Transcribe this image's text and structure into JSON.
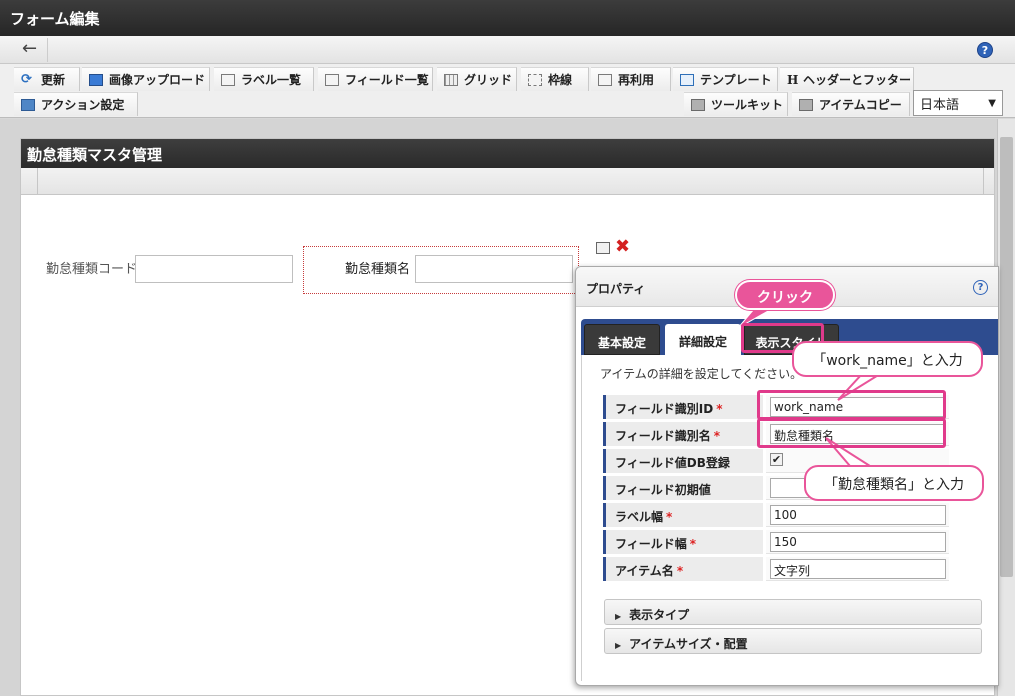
{
  "window": {
    "title": "フォーム編集"
  },
  "nav": {
    "back_icon": "←",
    "help_icon": "?"
  },
  "toolbar": {
    "row1": [
      "更新",
      "画像アップロード",
      "ラベル一覧",
      "フィールド一覧",
      "グリッド",
      "枠線",
      "再利用",
      "テンプレート",
      "ヘッダーとフッター"
    ],
    "row2_left": [
      "アクション設定"
    ],
    "row2_right": [
      "ツールキット",
      "アイテムコピー"
    ],
    "language": "日本語"
  },
  "form": {
    "title": "勤怠種類マスタ管理",
    "field1_label": "勤怠種類コード",
    "field2_label": "勤怠種類名"
  },
  "properties": {
    "title": "プロパティ",
    "help_icon": "?",
    "tabs": [
      "基本設定",
      "詳細設定",
      "表示スタイル"
    ],
    "active_tab": "詳細設定",
    "description": "アイテムの詳細を設定してください。",
    "rows": [
      {
        "label": "フィールド識別ID",
        "required": "*",
        "value": "work_name"
      },
      {
        "label": "フィールド識別名",
        "required": "*",
        "value": "勤怠種類名"
      },
      {
        "label": "フィールド値DB登録",
        "required": "",
        "checked": "✔"
      },
      {
        "label": "フィールド初期値",
        "required": "",
        "value": ""
      },
      {
        "label": "ラベル幅",
        "required": "*",
        "value": "100"
      },
      {
        "label": "フィールド幅",
        "required": "*",
        "value": "150"
      },
      {
        "label": "アイテム名",
        "required": "*",
        "value": "文字列"
      }
    ],
    "accordions": [
      "表示タイプ",
      "アイテムサイズ・配置"
    ]
  },
  "annotations": {
    "click": "クリック",
    "input_id": "「work_name」と入力",
    "input_name": "「勤怠種類名」と入力"
  },
  "colors": {
    "accent_pink": "#e9559a",
    "tab_blue": "#2e4c8f",
    "header_dark": "#2a2a2a"
  }
}
